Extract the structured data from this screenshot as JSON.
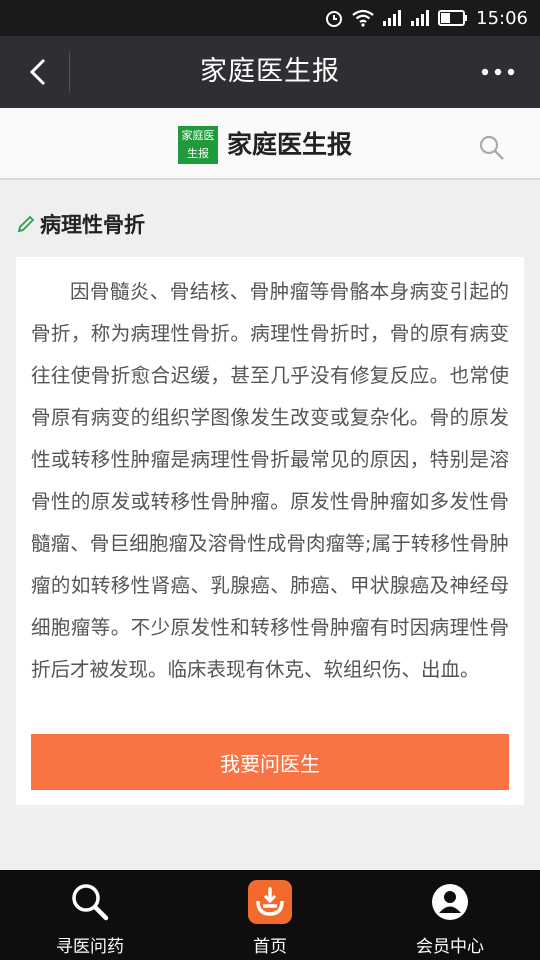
{
  "status_bar": {
    "time": "15:06",
    "icons": [
      "alarm-icon",
      "wifi-icon",
      "signal-icon",
      "signal-icon",
      "battery-icon"
    ]
  },
  "titlebar": {
    "title": "家庭医生报",
    "back_icon": "chevron-left-icon",
    "more_icon": "more-horizontal-icon"
  },
  "brand": {
    "logo_text": "家庭医生报",
    "name": "家庭医生报",
    "search_icon": "search-icon"
  },
  "article": {
    "title": "病理性骨折",
    "title_icon": "pencil-icon",
    "body": "因骨髓炎、骨结核、骨肿瘤等骨骼本身病变引起的骨折，称为病理性骨折。病理性骨折时，骨的原有病变往往使骨折愈合迟缓，甚至几乎没有修复反应。也常使骨原有病变的组织学图像发生改变或复杂化。骨的原发性或转移性肿瘤是病理性骨折最常见的原因，特别是溶骨性的原发或转移性骨肿瘤。原发性骨肿瘤如多发性骨髓瘤、骨巨细胞瘤及溶骨性成骨肉瘤等;属于转移性骨肿瘤的如转移性肾癌、乳腺癌、肺癌、甲状腺癌及神经母细胞瘤等。不少原发性和转移性骨肿瘤有时因病理性骨折后才被发现。临床表现有休克、软组织伤、出血。",
    "ask_button": "我要问医生"
  },
  "bottom_nav": {
    "items": [
      {
        "label": "寻医问药",
        "icon": "search-icon"
      },
      {
        "label": "首页",
        "icon": "home-icon"
      },
      {
        "label": "会员中心",
        "icon": "user-icon"
      }
    ]
  },
  "colors": {
    "accent": "#f97344",
    "brand_green": "#1f9a3c",
    "titlebar": "#2e2f33"
  }
}
